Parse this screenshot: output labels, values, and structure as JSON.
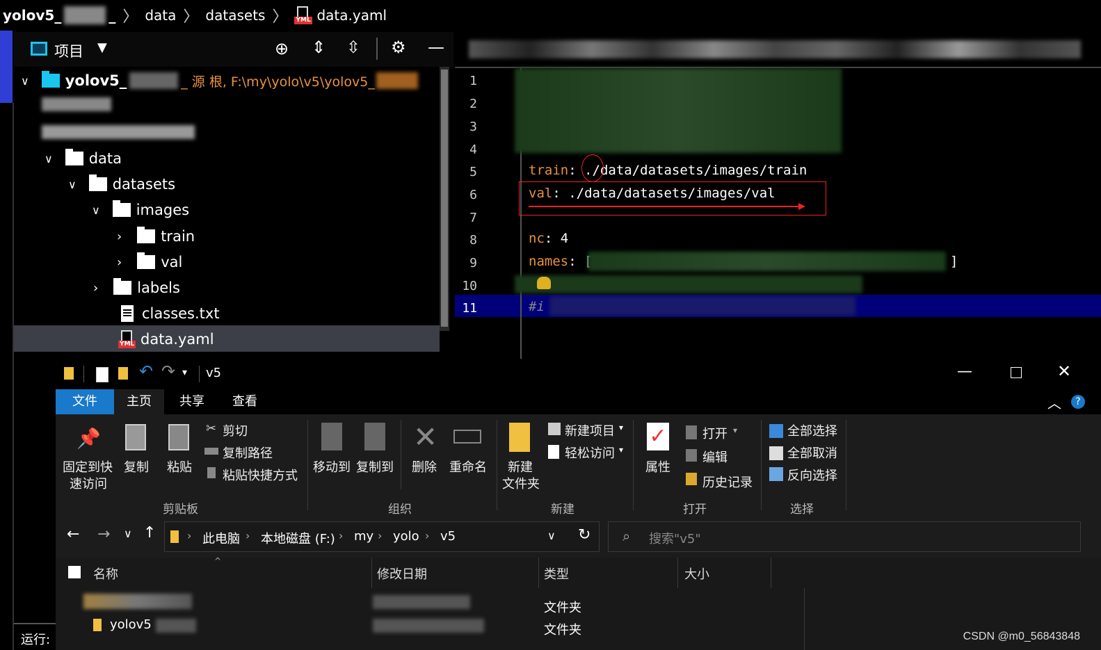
{
  "breadcrumb": {
    "project": "yolov5_",
    "items": [
      "data",
      "datasets",
      "data.yaml"
    ],
    "file_badge": "YML"
  },
  "project_panel": {
    "title": "项目",
    "root_name": "yolov5_",
    "root_suffix": "_ 源 根, F:\\my\\yolo\\v5\\yolov5_",
    "tree": [
      {
        "label": "data"
      },
      {
        "label": "datasets"
      },
      {
        "label": "images"
      },
      {
        "label": "train"
      },
      {
        "label": "val"
      },
      {
        "label": "labels"
      },
      {
        "label": "classes.txt"
      },
      {
        "label": "data.yaml"
      }
    ]
  },
  "editor": {
    "line_numbers": [
      "1",
      "2",
      "3",
      "4",
      "5",
      "6",
      "7",
      "8",
      "9",
      "10",
      "11"
    ],
    "line5_key": "train",
    "line5_rest": ": ./data/datasets/images/train",
    "line6_key": "val",
    "line6_rest": ": ./data/datasets/images/val",
    "line8_key": "nc",
    "line8_rest": ": 4",
    "line9_key": "names",
    "line9_rest": ": [",
    "line9_end": "]",
    "line11": "#i"
  },
  "explorer": {
    "title": "v5",
    "tabs": [
      "文件",
      "主页",
      "共享",
      "查看"
    ],
    "clipboard": {
      "pin": "固定到快",
      "pin2": "速访问",
      "copy": "复制",
      "paste": "粘贴",
      "cut": "剪切",
      "copy_path": "复制路径",
      "paste_shortcut": "粘贴快捷方式",
      "group": "剪贴板"
    },
    "organize": {
      "move_to": "移动到",
      "copy_to": "复制到",
      "delete": "删除",
      "rename": "重命名",
      "group": "组织"
    },
    "new": {
      "new_folder": "新建",
      "new_folder2": "文件夹",
      "new_item": "新建项目",
      "easy_access": "轻松访问",
      "group": "新建"
    },
    "open": {
      "properties": "属性",
      "open": "打开",
      "edit": "编辑",
      "history": "历史记录",
      "group": "打开"
    },
    "select": {
      "select_all": "全部选择",
      "select_none": "全部取消",
      "invert": "反向选择",
      "group": "选择"
    },
    "address": [
      "此电脑",
      "本地磁盘 (F:)",
      "my",
      "yolo",
      "v5"
    ],
    "search_placeholder": "搜索\"v5\"",
    "columns": [
      "名称",
      "修改日期",
      "类型",
      "大小"
    ],
    "files": [
      {
        "name": "",
        "type": "文件夹"
      },
      {
        "name": "yolov5",
        "type": "文件夹"
      }
    ]
  },
  "run_label": "运行:",
  "watermark": "CSDN @m0_56843848",
  "colors": {
    "accent_blue": "#1979ca",
    "code_key": "#e8923c",
    "selection": "#00007a"
  }
}
